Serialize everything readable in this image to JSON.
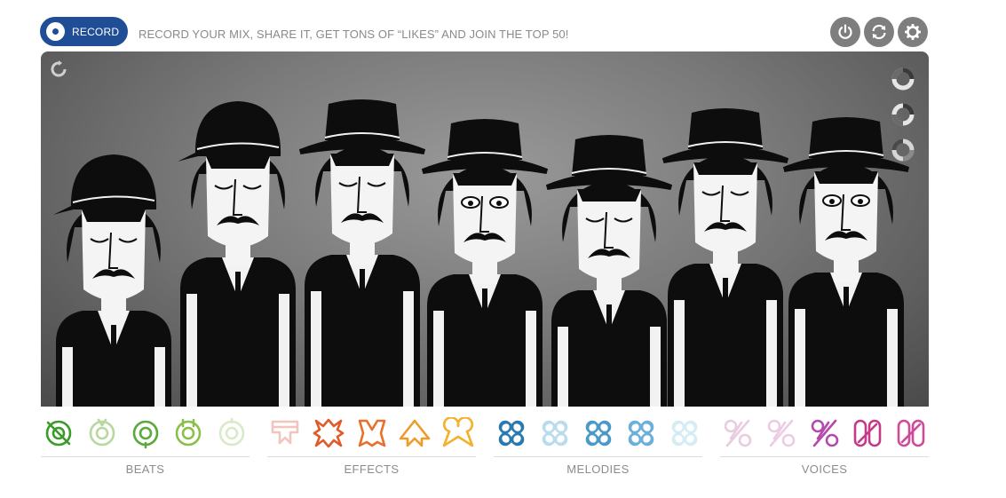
{
  "topbar": {
    "record_label": "RECORD",
    "tagline": "RECORD YOUR MIX, SHARE IT, GET TONS OF “LIKES” AND JOIN THE TOP 50!",
    "icons": [
      "power-icon",
      "refresh-icon",
      "settings-icon"
    ]
  },
  "stage": {
    "character_count": 7,
    "side_controls": [
      "mute-toggle",
      "solo-toggle",
      "bonus-toggle"
    ]
  },
  "groups": [
    {
      "label": "BEATS",
      "icons": [
        "beat-1",
        "beat-2",
        "beat-3",
        "beat-4",
        "beat-5"
      ],
      "colors": [
        "#3a9a2a",
        "#b8d8a0",
        "#5aaa3a",
        "#8ac04a",
        "#d8eac8"
      ]
    },
    {
      "label": "EFFECTS",
      "icons": [
        "effect-1",
        "effect-2",
        "effect-3",
        "effect-4",
        "effect-5"
      ],
      "colors": [
        "#f2c4be",
        "#e05a2a",
        "#e8702a",
        "#f09a28",
        "#f4b02a"
      ]
    },
    {
      "label": "MELODIES",
      "icons": [
        "melody-1",
        "melody-2",
        "melody-3",
        "melody-4",
        "melody-5"
      ],
      "colors": [
        "#2a7ab0",
        "#b8dcec",
        "#4a9ac8",
        "#6ab0d8",
        "#d4ecf4"
      ]
    },
    {
      "label": "VOICES",
      "icons": [
        "voice-1",
        "voice-2",
        "voice-3",
        "voice-4",
        "voice-5"
      ],
      "colors": [
        "#e8cce0",
        "#eccce4",
        "#b44aac",
        "#c43a88",
        "#d04a9a"
      ]
    }
  ]
}
